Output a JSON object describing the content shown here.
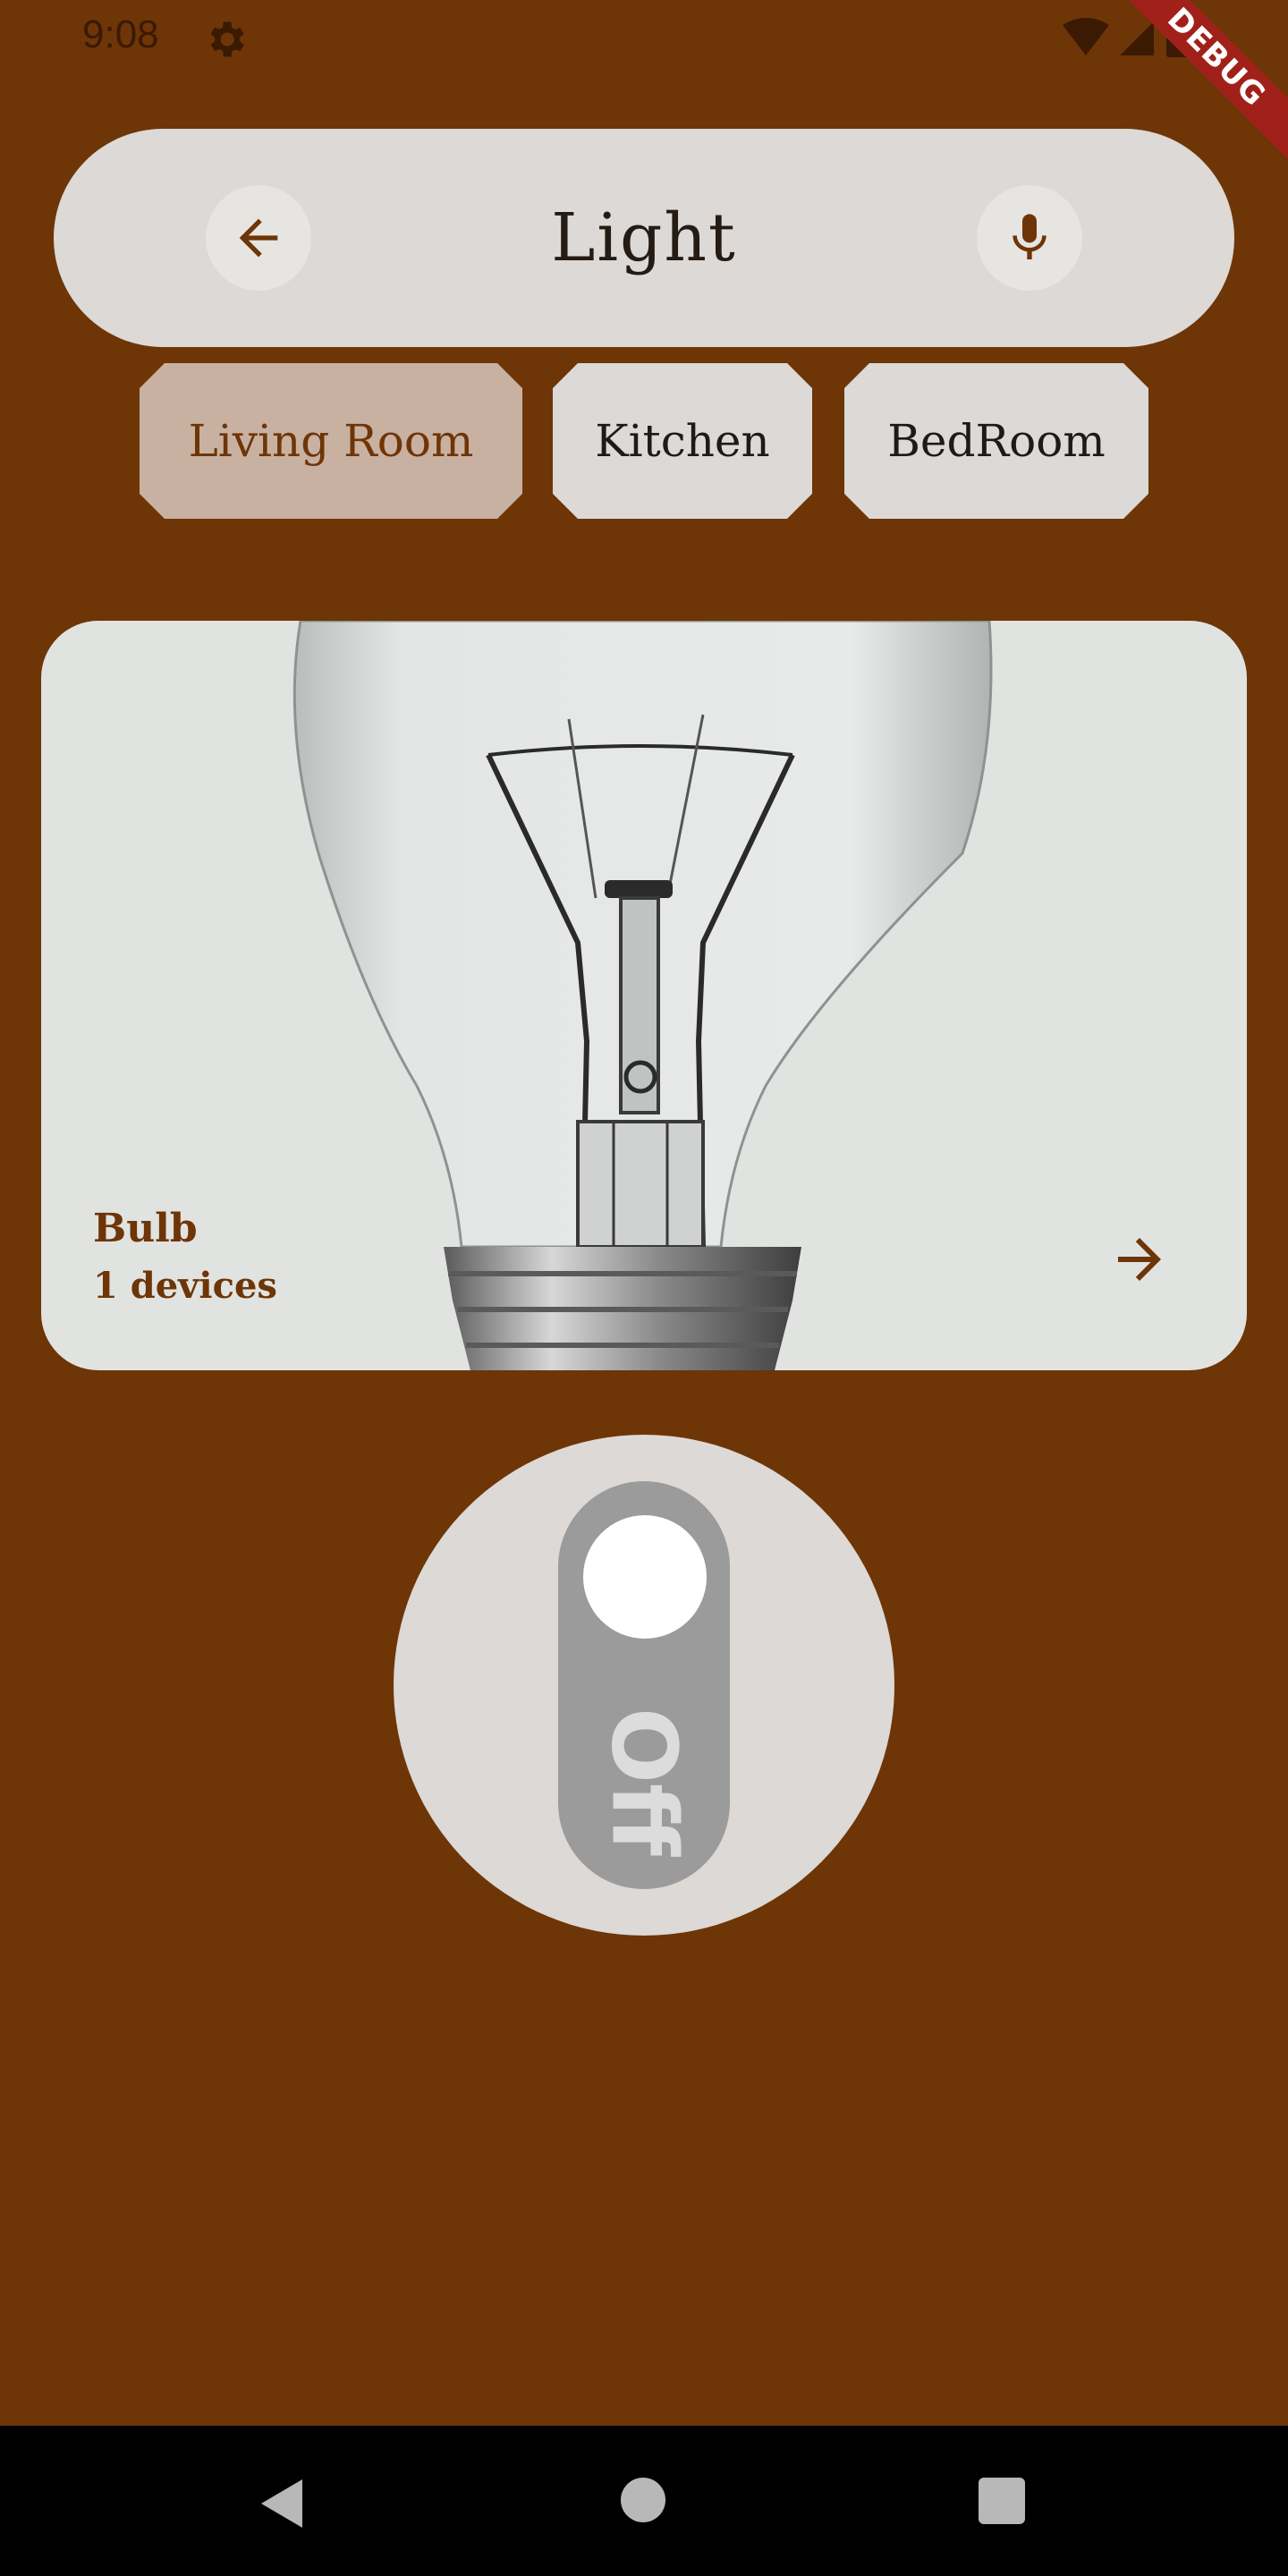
{
  "status_bar": {
    "time": "9:08"
  },
  "debug_banner": {
    "label": "DEBUG"
  },
  "header": {
    "title": "Light"
  },
  "rooms": [
    {
      "label": "Living Room",
      "selected": true
    },
    {
      "label": "Kitchen",
      "selected": false
    },
    {
      "label": "BedRoom",
      "selected": false
    }
  ],
  "device_card": {
    "name": "Bulb",
    "count": "1 devices"
  },
  "power_toggle": {
    "state_label": "Off",
    "is_on": false
  },
  "colors": {
    "background": "#6e3507",
    "surface": "#dcd9d6",
    "selected_tab": "#c9b1a2",
    "accent": "#6e3507",
    "toggle_track": "#9b9b9b"
  }
}
